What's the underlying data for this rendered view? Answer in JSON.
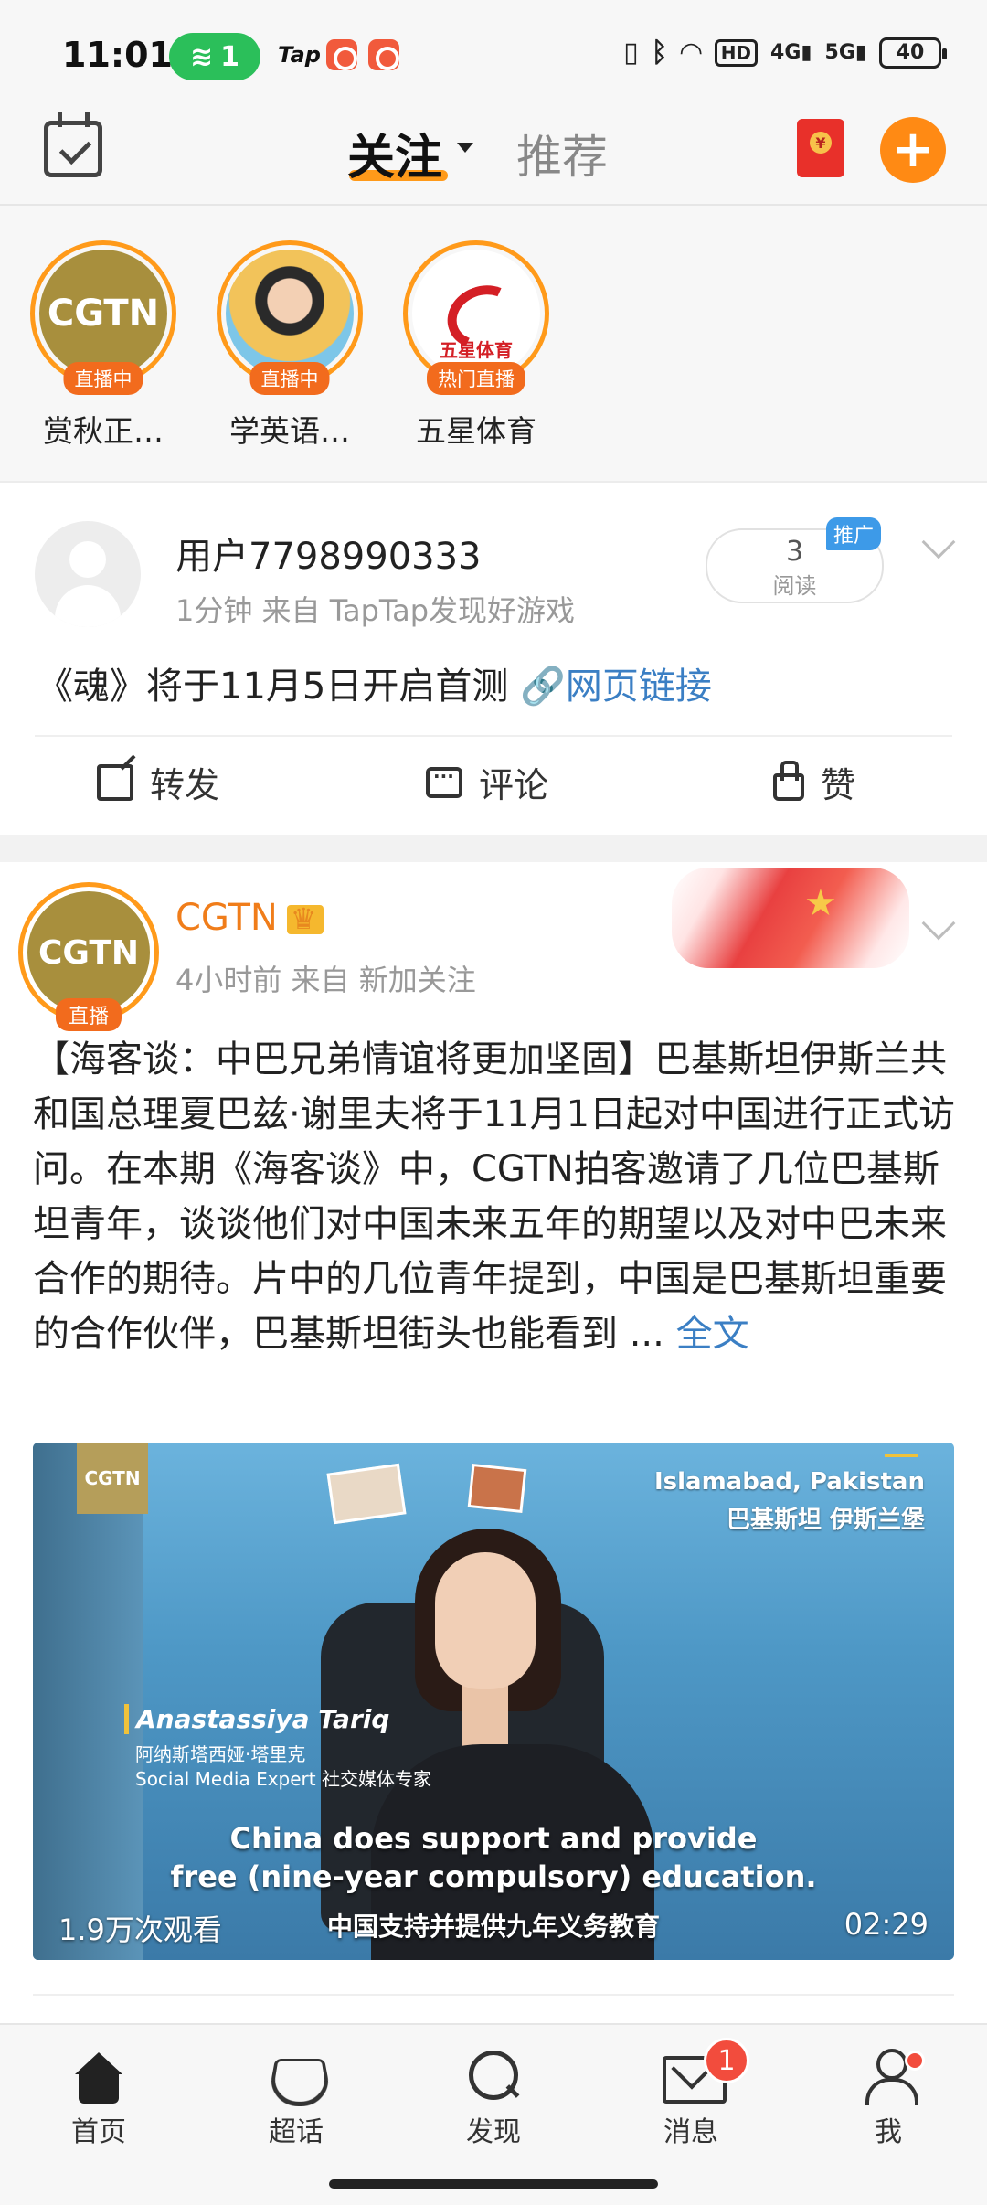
{
  "status_bar": {
    "time": "11:01",
    "hotspot_count": "1",
    "tap_label": "Tap",
    "network_labels": [
      "HD",
      "4G",
      "5G"
    ],
    "battery": "40"
  },
  "header": {
    "tab_follow": "关注",
    "tab_recommend": "推荐",
    "plus_label": "+"
  },
  "live_strip": [
    {
      "name": "赏秋正…",
      "badge": "直播中",
      "avatar_text": "CGTN"
    },
    {
      "name": "学英语…",
      "badge": "直播中",
      "avatar_text": ""
    },
    {
      "name": "五星体育",
      "badge": "热门直播",
      "avatar_text": "五星体育"
    }
  ],
  "post1": {
    "user": "用户7798990333",
    "meta": "1分钟  来自 TapTap发现好游戏",
    "read_count": "3",
    "read_label": "阅读",
    "promo_badge": "推广",
    "content": "《魂》将于11月5日开启首测 ",
    "link_icon": "🔗",
    "link_text": "网页链接",
    "actions": {
      "repost": "转发",
      "comment": "评论",
      "like": "赞"
    }
  },
  "post2": {
    "user": "CGTN",
    "avatar_text": "CGTN",
    "live_badge": "直播",
    "meta": "4小时前  来自 新加关注",
    "text": "【海客谈：中巴兄弟情谊将更加坚固】巴基斯坦伊斯兰共和国总理夏巴兹·谢里夫将于11月1日起对中国进行正式访问。在本期《海客谈》中，CGTN拍客邀请了几位巴基斯坦青年，谈谈他们对中国未来五年的期望以及对中巴未来合作的期待。片中的几位青年提到，中国是巴基斯坦重要的合作伙伴，巴基斯坦街头也能看到 ... ",
    "more": "全文",
    "video": {
      "cgtn_tag": "CGTN",
      "location_en": "Islamabad, Pakistan",
      "location_cn": "巴基斯坦 伊斯兰堡",
      "speaker_name": "Anastassiya Tariq",
      "speaker_name_cn": "阿纳斯塔西娅·塔里克",
      "speaker_role": "Social Media Expert 社交媒体专家",
      "subtitle_en_1": "China does support and provide",
      "subtitle_en_2": "free (nine-year compulsory) education.",
      "subtitle_cn": "中国支持并提供九年义务教育",
      "views": "1.9万次观看",
      "duration": "02:29"
    }
  },
  "bottom_nav": [
    {
      "label": "首页",
      "icon": "home-icon"
    },
    {
      "label": "超话",
      "icon": "diamond-icon"
    },
    {
      "label": "发现",
      "icon": "search-icon"
    },
    {
      "label": "消息",
      "icon": "mail-icon"
    },
    {
      "label": "我",
      "icon": "user-icon"
    }
  ],
  "message_badge": "1",
  "colors": {
    "accent_orange": "#ff8a14",
    "link_blue": "#3b7fc4",
    "live_badge": "#f26b1d",
    "username_orange": "#f07d1a"
  }
}
